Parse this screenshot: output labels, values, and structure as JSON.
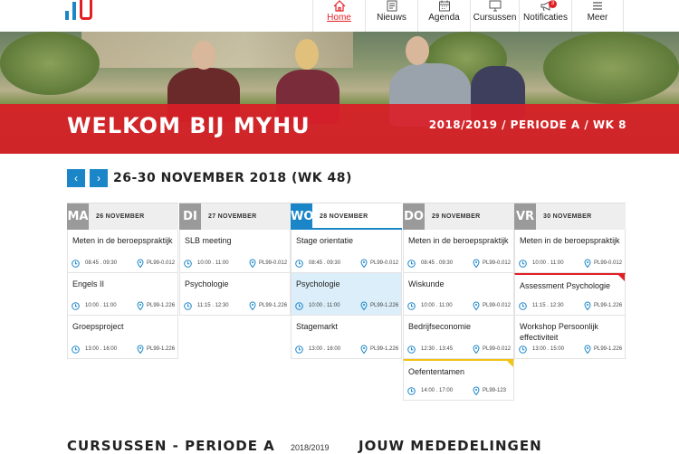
{
  "nav": {
    "items": [
      {
        "label": "Home",
        "icon": "home-icon",
        "active": true
      },
      {
        "label": "Nieuws",
        "icon": "news-icon"
      },
      {
        "label": "Agenda",
        "icon": "calendar-icon"
      },
      {
        "label": "Cursussen",
        "icon": "monitor-icon"
      },
      {
        "label": "Notificaties",
        "icon": "megaphone-icon",
        "badge": "3"
      },
      {
        "label": "Meer",
        "icon": "menu-icon"
      }
    ]
  },
  "hero": {
    "title": "WELKOM BIJ MYHU",
    "period": "2018/2019 / PERIODE A / WK 8"
  },
  "week": {
    "prev_label": "‹",
    "next_label": "›",
    "title": "26-30 NOVEMBER 2018 (WK 48)"
  },
  "days": [
    {
      "abbr": "MA",
      "date": "26 NOVEMBER",
      "events": [
        {
          "title": "Meten in de beroepspraktijk",
          "time": "08:45 . 09:30",
          "room": "PL99-0.012"
        },
        {
          "title": "Engels II",
          "time": "10:00 . 11:00",
          "room": "PL99-1.226"
        },
        {
          "title": "Groepsproject",
          "time": "13:00 . 16:00",
          "room": "PL99-1.226"
        }
      ]
    },
    {
      "abbr": "DI",
      "date": "27 NOVEMBER",
      "events": [
        {
          "title": "SLB meeting",
          "time": "10:00 . 11:00",
          "room": "PL99-0.012"
        },
        {
          "title": "Psychologie",
          "time": "11:15 . 12:30",
          "room": "PL99-1.226"
        }
      ]
    },
    {
      "abbr": "WO",
      "date": "28 NOVEMBER",
      "today": true,
      "events": [
        {
          "title": "Stage orientatie",
          "time": "08:45 . 09:30",
          "room": "PL99-0.012"
        },
        {
          "title": "Psychologie",
          "time": "10:00 . 11:00",
          "room": "PL99-1.226",
          "highlight": true
        },
        {
          "title": "Stagemarkt",
          "time": "13:00 . 16:00",
          "room": "PL99-1.226"
        }
      ]
    },
    {
      "abbr": "DO",
      "date": "29 NOVEMBER",
      "events": [
        {
          "title": "Meten in de beroepspraktijk",
          "time": "08:45 . 09:30",
          "room": "PL99-0.012"
        },
        {
          "title": "Wiskunde",
          "time": "10:00 . 11:00",
          "room": "PL99-0.012"
        },
        {
          "title": "Bedrijfseconomie",
          "time": "12:30 . 13:45",
          "room": "PL99-0.012"
        },
        {
          "title": "Oefententamen",
          "time": "14:00 . 17:00",
          "room": "PL99-123",
          "flag": "yellow"
        }
      ]
    },
    {
      "abbr": "VR",
      "date": "30 NOVEMBER",
      "events": [
        {
          "title": "Meten in de beroepspraktijk",
          "time": "10:00 . 11:00",
          "room": "PL99-0.012"
        },
        {
          "title": "Assessment Psychologie",
          "time": "11:15 . 12:30",
          "room": "PL99-1.226",
          "flag": "red"
        },
        {
          "title": "Workshop Persoonlijk effectiviteit",
          "time": "13:00 . 15:00",
          "room": "PL99-1.226"
        }
      ]
    }
  ],
  "sections": {
    "courses_title": "CURSUSSEN - PERIODE A",
    "courses_year": "2018/2019",
    "announcements_title": "JOUW MEDEDELINGEN"
  },
  "colors": {
    "brand_red": "#e31f26",
    "brand_blue": "#1a86c8",
    "highlight": "#dbeef9",
    "flag_yellow": "#f2c314"
  }
}
